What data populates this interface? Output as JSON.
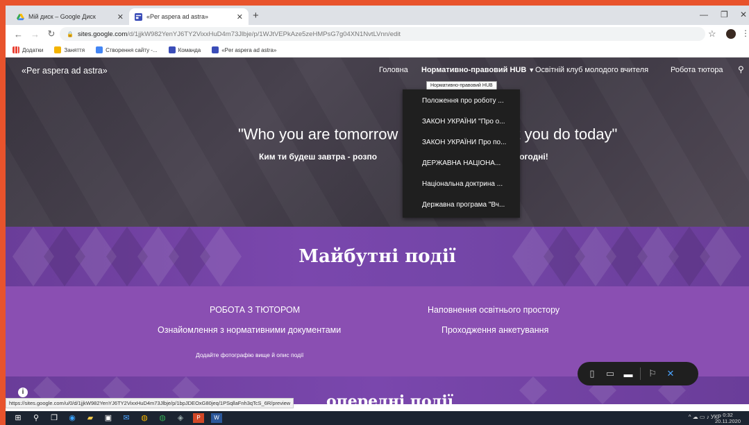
{
  "browser": {
    "tabs": [
      {
        "title": "Мій диск – Google Диск",
        "active": false
      },
      {
        "title": "«Per aspera ad astra»",
        "active": true
      }
    ],
    "new_tab": "+",
    "url_host": "sites.google.com",
    "url_path": "/d/1jjkW982YenYJ6TY2VixxHuD4m73Jlbje/p/1WJtVEPkAze5zeHMPsG7g04XN1NvtLVnn/edit",
    "bookmarks": [
      "Додатки",
      "Заняття",
      "Створення сайту -...",
      "Команда",
      "«Per aspera ad astra»"
    ],
    "status_url": "https://sites.google.com/u/0/d/1jjkW982YenYJ6TY2VixxHuD4m73Jlbje/p/1bpJDEOxG80jeq/1PSqllaFnh3qTcS_6R/preview"
  },
  "site": {
    "brand": "«Per aspera ad astra»",
    "nav": [
      {
        "label": "Головна"
      },
      {
        "label": "Нормативно-правовий HUB"
      },
      {
        "label": "Освітній клуб молодого вчителя"
      },
      {
        "label": "Робота тютора"
      }
    ],
    "tooltip": "Нормативно-правовий   HUB",
    "dropdown": [
      "Положення про роботу ...",
      "ЗАКОН УКРАЇНИ \"Про о...",
      "ЗАКОН УКРАЇНИ Про по...",
      "ДЕРЖАВНА НАЦІОНА...",
      "Національна доктрина ...",
      "Державна програма \"Вч..."
    ],
    "quote": "\"Who you are tomorrow",
    "quote_end": "t you do today\"",
    "subquote": "Ким ти будеш завтра - розпо",
    "subquote_end": "биш сьогодні!",
    "section_title": "Майбутні події",
    "events": {
      "col1_top": "РОБОТА З ТЮТОРОМ",
      "col1_bottom": "Ознайомлення з нормативними документами",
      "col2_top": "Наповнення освітнього простору",
      "col2_bottom": "Проходження анкетування",
      "hint": "Додайте фотографію вище й опис події"
    },
    "section2_title": "опередні події"
  },
  "taskbar": {
    "language": "УКР",
    "time": "0:32",
    "date": "20.11.2020"
  },
  "colors": {
    "hero": "#3f3a45",
    "purple_band": "#7446a8",
    "events_bg": "#8a4fb2",
    "taskbar": "#1c2431",
    "accent_blue": "#4aa3ff"
  }
}
